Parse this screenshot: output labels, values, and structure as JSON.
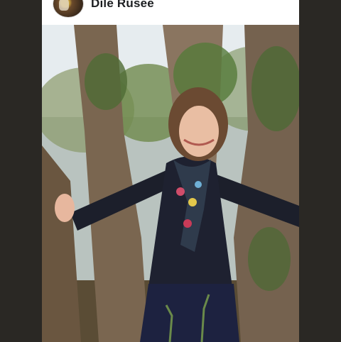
{
  "post": {
    "author_name": "Dile Rusee",
    "avatar_icon": "profile-avatar",
    "photo_icon": "woman-in-forest-photo"
  }
}
